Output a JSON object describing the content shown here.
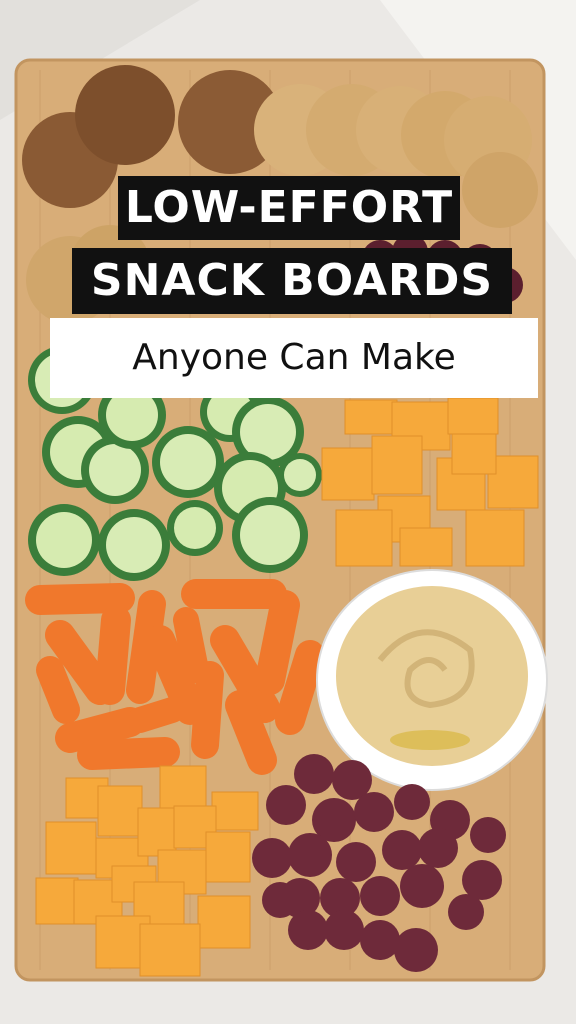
{
  "title": {
    "line1": "LOW-EFFORT",
    "line2": "SNACK BOARDS",
    "subtitle": "Anyone Can Make"
  },
  "image": {
    "items": [
      "crackers",
      "grapes",
      "cucumber-slices",
      "cheese-cubes",
      "baby-carrots",
      "hummus-bowl",
      "cheddar-cubes",
      "red-grapes"
    ]
  },
  "colors": {
    "background": "#e9e7e4",
    "board": "#dcb07a",
    "title_bg": "#111111",
    "title_text": "#ffffff",
    "subtitle_bg": "#ffffff",
    "cheese": "#f6a93b",
    "carrot": "#f0792d",
    "cucumber": "#8bc34a",
    "hummus": "#e6cf97",
    "grape": "#6e2a3a"
  }
}
